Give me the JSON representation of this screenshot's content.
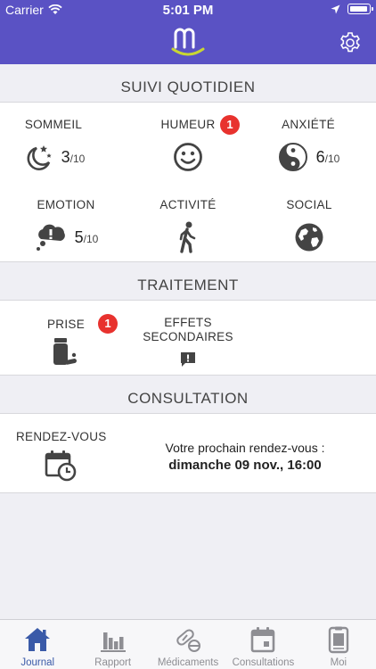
{
  "status_bar": {
    "carrier": "Carrier",
    "time": "5:01 PM"
  },
  "sections": {
    "daily": "SUIVI QUOTIDIEN",
    "treatment": "TRAITEMENT",
    "consultation": "CONSULTATION"
  },
  "daily": {
    "sleep": {
      "label": "SOMMEIL",
      "value": "3",
      "scale": "/10",
      "icon": "moon-stars-icon"
    },
    "mood": {
      "label": "HUMEUR",
      "badge": "1",
      "icon": "smiley-icon"
    },
    "anxiety": {
      "label": "ANXIÉTÉ",
      "value": "6",
      "scale": "/10",
      "icon": "yin-yang-icon"
    },
    "emotion": {
      "label": "EMOTION",
      "value": "5",
      "scale": "/10",
      "icon": "thought-bubble-icon"
    },
    "activity": {
      "label": "ACTIVITÉ",
      "icon": "walking-person-icon"
    },
    "social": {
      "label": "SOCIAL",
      "icon": "globe-icon"
    }
  },
  "treatment": {
    "intake": {
      "label": "PRISE",
      "badge": "1",
      "icon": "pill-bottle-icon"
    },
    "side_effects": {
      "label_line1": "EFFETS",
      "label_line2": "SECONDAIRES",
      "icon": "alert-message-icon"
    }
  },
  "consultation": {
    "label": "RENDEZ-VOUS",
    "next_text": "Votre prochain rendez-vous :",
    "next_date": "dimanche 09 nov., 16:00",
    "icon": "calendar-clock-icon"
  },
  "tabs": [
    {
      "label": "Journal",
      "icon": "home-icon",
      "active": true
    },
    {
      "label": "Rapport",
      "icon": "bar-chart-icon",
      "active": false
    },
    {
      "label": "Médicaments",
      "icon": "pills-icon",
      "active": false
    },
    {
      "label": "Consultations",
      "icon": "calendar-icon",
      "active": false
    },
    {
      "label": "Moi",
      "icon": "profile-document-icon",
      "active": false
    }
  ],
  "colors": {
    "header": "#5a52c4",
    "badge": "#e8322e",
    "active_tab": "#3a5aa8",
    "logo_smile": "#c8d633"
  }
}
